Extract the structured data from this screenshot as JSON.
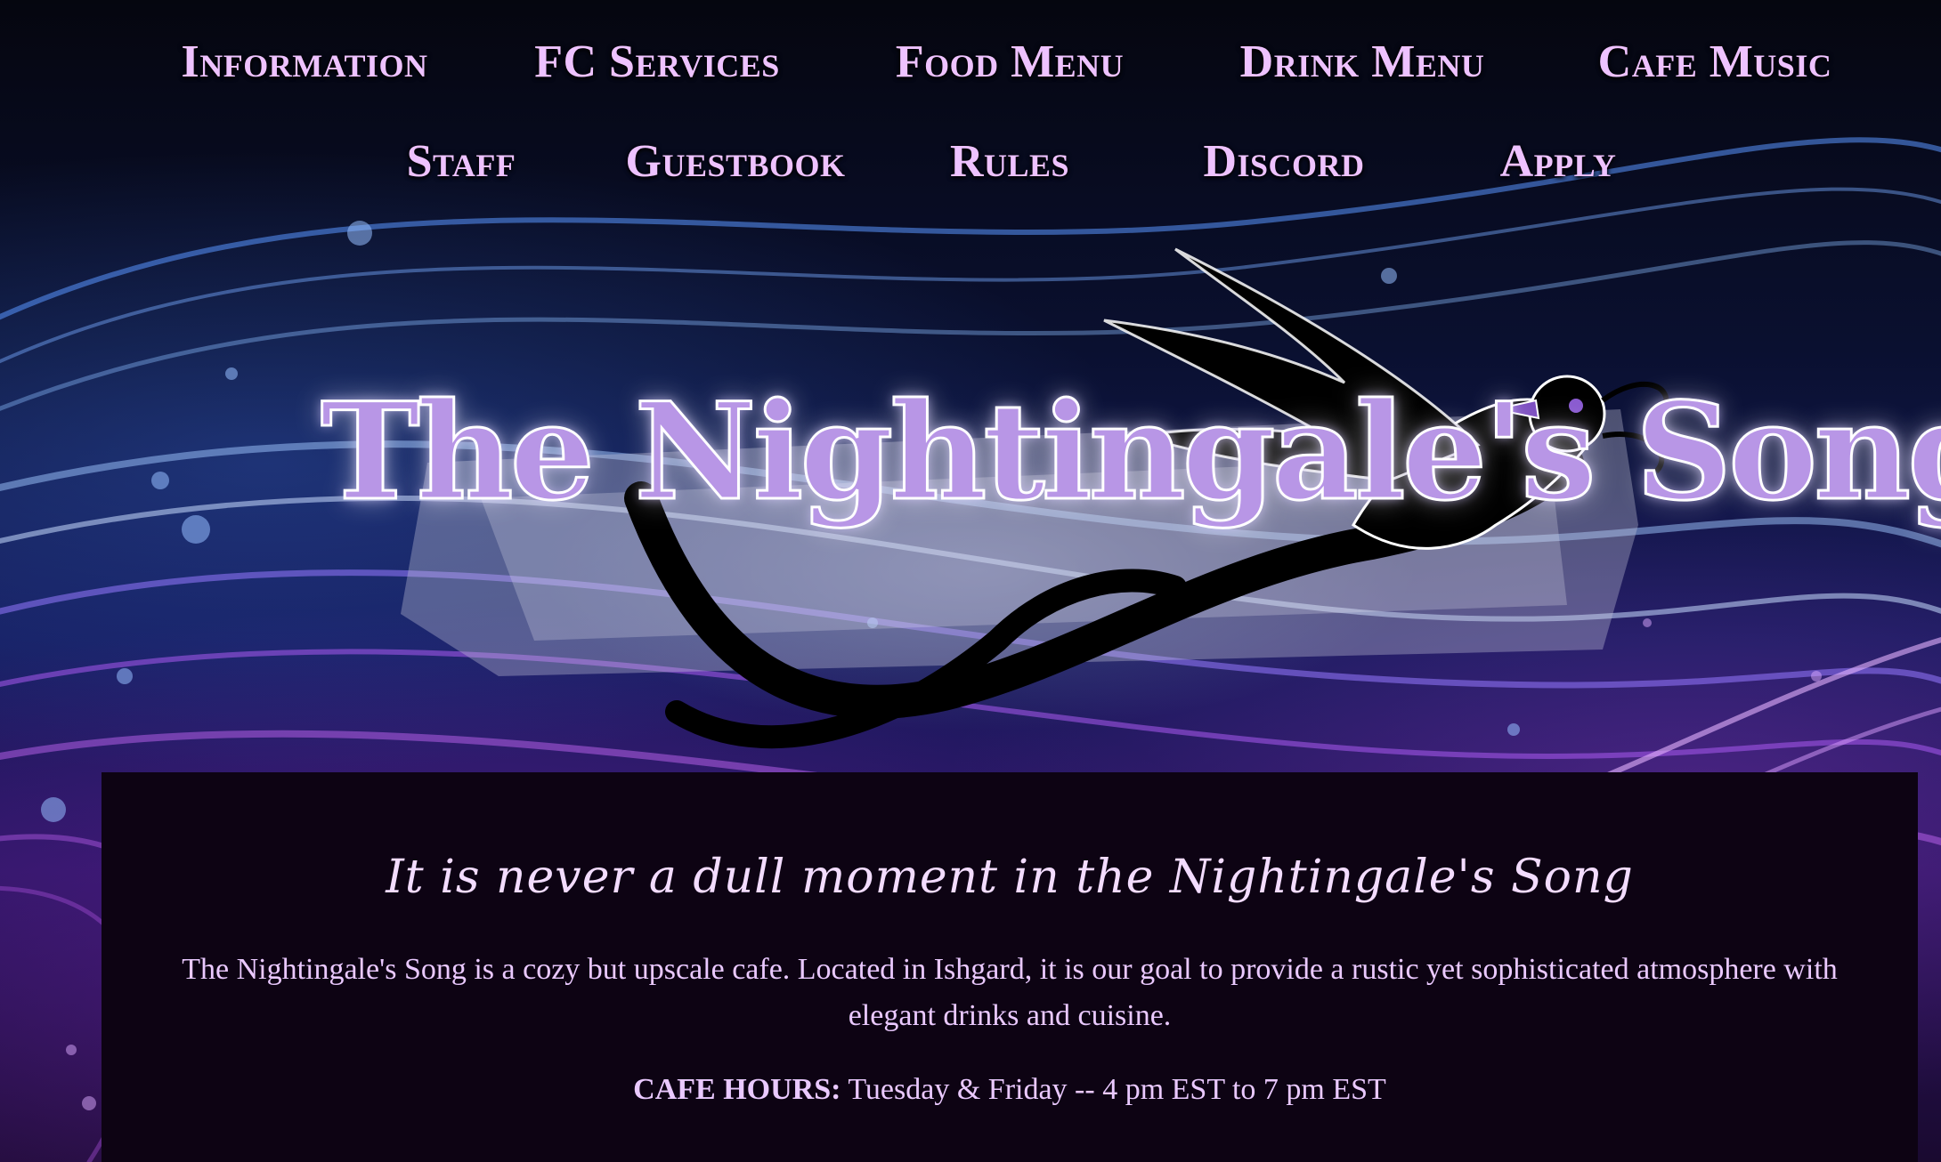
{
  "nav": {
    "row1": [
      {
        "label": "Information"
      },
      {
        "label": "FC Services"
      },
      {
        "label": "Food Menu"
      },
      {
        "label": "Drink Menu"
      },
      {
        "label": "Cafe Music"
      }
    ],
    "row2": [
      {
        "label": "Staff"
      },
      {
        "label": "Guestbook"
      },
      {
        "label": "Rules"
      },
      {
        "label": "Discord"
      },
      {
        "label": "Apply"
      }
    ]
  },
  "logo": {
    "text": "The Nightingale's Song"
  },
  "main": {
    "tagline": "It is never a dull moment in the Nightingale's Song",
    "description": "The Nightingale's Song is a cozy but upscale cafe. Located in Ishgard, it is our goal to provide a rustic yet sophisticated atmosphere with elegant drinks and cuisine.",
    "hours_label": "CAFE HOURS:",
    "hours_value": "Tuesday & Friday -- 4 pm EST to 7 pm EST"
  },
  "colors": {
    "nav_text": "#eec2ff",
    "logo_fill": "#b896e6",
    "content_bg": "#0d0313",
    "content_text": "#eac9ff"
  }
}
